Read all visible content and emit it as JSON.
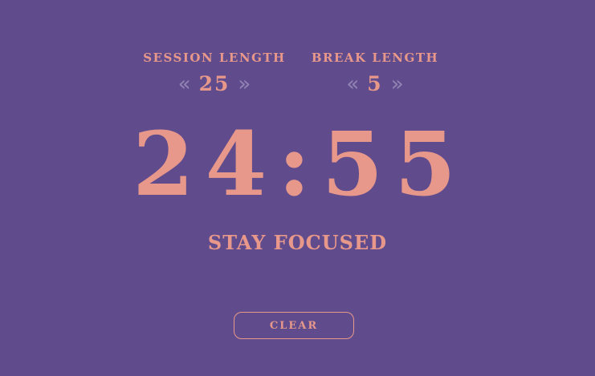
{
  "session": {
    "label": "SESSION LENGTH",
    "decrement_glyph": "«",
    "value": "25",
    "increment_glyph": "»"
  },
  "break": {
    "label": "BREAK LENGTH",
    "decrement_glyph": "«",
    "value": "5",
    "increment_glyph": "»"
  },
  "timer": {
    "display": "24:55"
  },
  "status": {
    "text": "STAY FOCUSED"
  },
  "actions": {
    "clear_label": "CLEAR"
  },
  "colors": {
    "background": "#604c8d",
    "accent": "#e8988a",
    "arrow": "#9184b3"
  }
}
